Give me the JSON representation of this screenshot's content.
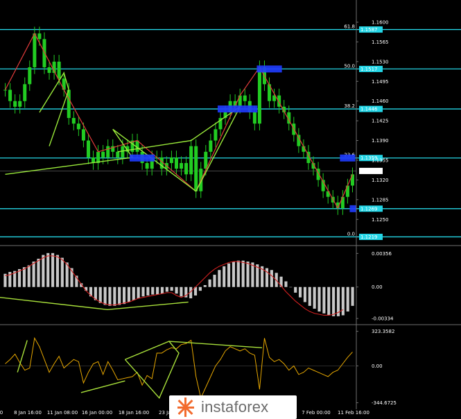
{
  "colors": {
    "background": "#000000",
    "level_line": "#24d6e6",
    "level_label_bg": "#24d6e6",
    "zone": "#1f3cff",
    "candle": "#22cc22",
    "pattern": "#9aea3a",
    "zigzag": "#e23b3b",
    "trend": "#a8e03a",
    "histogram": "#c8c8c8",
    "signal": "#d42020",
    "cci": "#e8a800",
    "cci_pattern": "#a8e03a",
    "separator": "#707070",
    "text": "#ffffff"
  },
  "chart_data": [
    {
      "type": "line",
      "pane": "price",
      "ylim": [
        1.1206,
        1.1632
      ],
      "y_ticks": [
        "1.1600",
        "1.1565",
        "1.1530",
        "1.1495",
        "1.1460",
        "1.1425",
        "1.1390",
        "1.1355",
        "1.1320",
        "1.1285",
        "1.1250"
      ],
      "x_ticks": [
        "0",
        "8 Jan 16:00",
        "11 Jan 08:00",
        "16 Jan 00:00",
        "18 Jan 16:00",
        "23 Jan",
        "7 Feb 00:00",
        "11 Feb 16:00"
      ],
      "fib_levels": [
        {
          "label": "61.8",
          "value": "1.1587"
        },
        {
          "label": "50.0",
          "value": "1.1517"
        },
        {
          "label": "38.2",
          "value": "1.1446"
        },
        {
          "label": "23.6",
          "value": "1.1359"
        },
        {
          "label": "",
          "value": "1.1269"
        },
        {
          "label": "0.0",
          "value": "1.1219"
        }
      ],
      "current_price": "1.1336",
      "series": [
        {
          "values": [
            1.148,
            1.146,
            1.145,
            1.146,
            1.149,
            1.152,
            1.158,
            1.157,
            1.152,
            1.151,
            1.153,
            1.15,
            1.148,
            1.143,
            1.142,
            1.141,
            1.139,
            1.136,
            1.135,
            1.137,
            1.136,
            1.138,
            1.137,
            1.136,
            1.138,
            1.137,
            1.139,
            1.137,
            1.135,
            1.134,
            1.136,
            1.136,
            1.134,
            1.135,
            1.136,
            1.134,
            1.135,
            1.133,
            1.138,
            1.13,
            1.134,
            1.137,
            1.139,
            1.141,
            1.143,
            1.144,
            1.146,
            1.145,
            1.147,
            1.146,
            1.144,
            1.142,
            1.152,
            1.149,
            1.146,
            1.147,
            1.145,
            1.144,
            1.142,
            1.14,
            1.138,
            1.137,
            1.135,
            1.134,
            1.132,
            1.13,
            1.129,
            1.128,
            1.127,
            1.129,
            1.131,
            1.133
          ]
        }
      ]
    },
    {
      "type": "bar",
      "pane": "macd",
      "y_ticks": [
        "0.00356",
        "0.00",
        "-0.00334"
      ],
      "ylim": [
        -0.0037,
        0.0041
      ],
      "series": [
        {
          "name": "",
          "values": [
            0.0014,
            0.0016,
            0.0017,
            0.0019,
            0.0021,
            0.0023,
            0.0027,
            0.003,
            0.0034,
            0.0036,
            0.0036,
            0.0034,
            0.0031,
            0.0026,
            0.002,
            0.0012,
            0.0004,
            -0.0004,
            -0.001,
            -0.0014,
            -0.0017,
            -0.0019,
            -0.002,
            -0.002,
            -0.0019,
            -0.0018,
            -0.0016,
            -0.0014,
            -0.0012,
            -0.001,
            -0.0009,
            -0.0008,
            -0.0008,
            -0.0007,
            -0.0005,
            -0.0004,
            -0.0007,
            -0.001,
            -0.0011,
            -0.0012,
            -0.0009,
            -0.0004,
            0.0002,
            0.0008,
            0.0013,
            0.0018,
            0.0022,
            0.0025,
            0.0027,
            0.0028,
            0.0028,
            0.0027,
            0.0026,
            0.0024,
            0.0022,
            0.002,
            0.0018,
            0.0015,
            0.0011,
            0.0006,
            0.0,
            -0.0006,
            -0.0011,
            -0.0016,
            -0.002,
            -0.0023,
            -0.0026,
            -0.0028,
            -0.003,
            -0.0031,
            -0.0031,
            -0.003,
            -0.0026,
            -0.002
          ]
        },
        {
          "name": "",
          "values": [
            0.0012,
            0.0013,
            0.0015,
            0.0017,
            0.0019,
            0.0022,
            0.0025,
            0.0028,
            0.0031,
            0.0033,
            0.0033,
            0.0032,
            0.0029,
            0.0024,
            0.0017,
            0.001,
            0.0003,
            -0.0004,
            -0.0009,
            -0.0013,
            -0.0016,
            -0.0018,
            -0.0019,
            -0.0019,
            -0.0018,
            -0.0017,
            -0.0016,
            -0.0014,
            -0.0012,
            -0.0011,
            -0.001,
            -0.0009,
            -0.0008,
            -0.0007,
            -0.0006,
            -0.0006,
            -0.0009,
            -0.0011,
            -0.0009,
            -0.0005,
            0.0,
            0.0005,
            0.001,
            0.0015,
            0.0019,
            0.0022,
            0.0024,
            0.0026,
            0.0027,
            0.0027,
            0.0026,
            0.0025,
            0.0023,
            0.0021,
            0.0019,
            0.0016,
            0.0012,
            0.0007,
            0.0001,
            -0.0005,
            -0.001,
            -0.0015,
            -0.0019,
            -0.0023,
            -0.0026,
            -0.0028,
            -0.0029,
            -0.003,
            -0.003,
            -0.0029,
            -0.0027,
            -0.0024
          ]
        }
      ]
    },
    {
      "type": "line",
      "pane": "cci",
      "y_ticks": [
        "323.3582",
        "0.00",
        "-344.6725"
      ],
      "ylim": [
        -380,
        360
      ],
      "series": [
        {
          "name": "",
          "values": [
            20,
            60,
            110,
            30,
            -40,
            -20,
            260,
            180,
            60,
            -60,
            20,
            90,
            -20,
            20,
            60,
            40,
            -160,
            -60,
            20,
            40,
            -80,
            40,
            -40,
            -130,
            -120,
            -110,
            -100,
            -60,
            -180,
            -90,
            -120,
            120,
            120,
            150,
            170,
            160,
            200,
            210,
            240,
            -100,
            -300,
            -200,
            -100,
            0,
            60,
            140,
            180,
            160,
            140,
            160,
            120,
            100,
            -220,
            260,
            80,
            40,
            60,
            20,
            -40,
            0,
            -80,
            -60,
            -20,
            -40,
            -60,
            -80,
            -100,
            -60,
            -40,
            20,
            80,
            130
          ]
        }
      ]
    }
  ],
  "watermark": {
    "brand": "instaforex"
  }
}
